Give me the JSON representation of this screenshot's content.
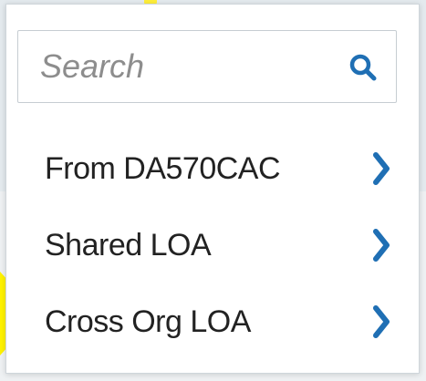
{
  "search": {
    "placeholder": "Search",
    "value": "",
    "icon": "search-icon"
  },
  "menu": {
    "items": [
      {
        "label": "From DA570CAC",
        "icon": "chevron-right-icon"
      },
      {
        "label": "Shared LOA",
        "icon": "chevron-right-icon"
      },
      {
        "label": "Cross Org LOA",
        "icon": "chevron-right-icon"
      }
    ]
  },
  "colors": {
    "accent": "#1f6fb4",
    "highlight": "#fff200",
    "text": "#222222",
    "placeholder": "#8d8d8d"
  }
}
